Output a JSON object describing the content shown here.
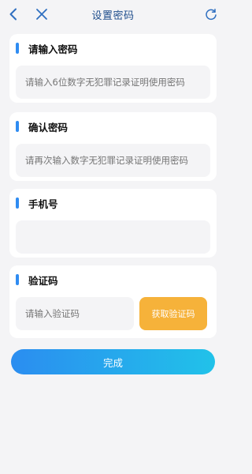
{
  "header": {
    "title": "设置密码",
    "back_icon": "chevron-left-icon",
    "close_icon": "close-icon",
    "refresh_icon": "refresh-icon"
  },
  "colors": {
    "accent": "#2f8cf2",
    "title": "#1e4d8c",
    "code_button": "#f6b23a",
    "submit_gradient_start": "#2b8df0",
    "submit_gradient_end": "#21c2e9",
    "background": "#f4f4f6"
  },
  "password": {
    "label": "请输入密码",
    "placeholder": "请输入6位数字无犯罪记录证明使用密码"
  },
  "confirm": {
    "label": "确认密码",
    "placeholder": "请再次输入数字无犯罪记录证明使用密码"
  },
  "phone": {
    "label": "手机号",
    "value": ""
  },
  "code": {
    "label": "验证码",
    "placeholder": "请输入验证码",
    "button_label": "获取验证码"
  },
  "submit": {
    "label": "完成"
  }
}
